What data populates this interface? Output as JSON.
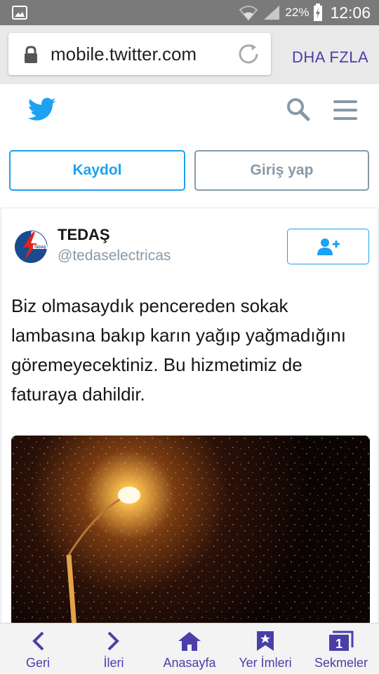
{
  "status_bar": {
    "battery_percent": "22%",
    "time": "12:06"
  },
  "browser": {
    "url": "mobile.twitter.com",
    "menu_label": "DHA FZLA"
  },
  "auth": {
    "signup_label": "Kaydol",
    "login_label": "Giriş yap"
  },
  "tweet": {
    "name": "TEDAŞ",
    "handle": "@tedaselectricas",
    "text": "Biz olmasaydık pencereden sokak lambasına bakıp karın yağıp yağmadığını göremeyecektiniz. Bu hizmetimiz de faturaya dahildir."
  },
  "toolbar": {
    "back": "Geri",
    "forward": "İleri",
    "home": "Anasayfa",
    "bookmarks": "Yer İmleri",
    "tabs": "Sekmeler",
    "tab_count": "1"
  },
  "colors": {
    "twitter_blue": "#1da1f2",
    "browser_accent": "#4a3fa8",
    "muted": "#8899a6"
  }
}
